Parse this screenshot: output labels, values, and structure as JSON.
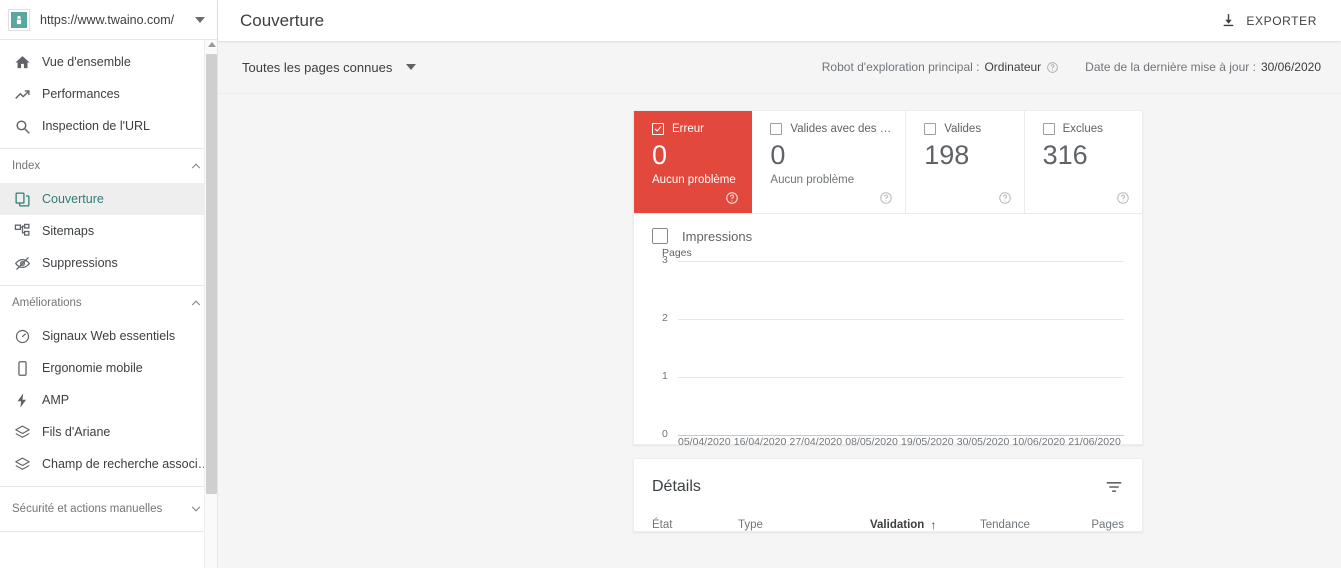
{
  "sidebar": {
    "property": {
      "url": "https://www.twaino.com/",
      "favicon_name": "site-favicon",
      "favicon_color": "#5ba6a0"
    },
    "top_items": [
      {
        "label": "Vue d'ensemble",
        "icon": "home-icon"
      },
      {
        "label": "Performances",
        "icon": "trending-up-icon"
      },
      {
        "label": "Inspection de l'URL",
        "icon": "search-icon"
      }
    ],
    "sections": [
      {
        "label": "Index",
        "expanded": true,
        "items": [
          {
            "label": "Couverture",
            "icon": "pages-copy-icon",
            "active": true
          },
          {
            "label": "Sitemaps",
            "icon": "sitemap-icon",
            "active": false
          },
          {
            "label": "Suppressions",
            "icon": "eye-off-icon",
            "active": false
          }
        ]
      },
      {
        "label": "Améliorations",
        "expanded": true,
        "items": [
          {
            "label": "Signaux Web essentiels",
            "icon": "speedometer-icon",
            "active": false
          },
          {
            "label": "Ergonomie mobile",
            "icon": "mobile-phone-icon",
            "active": false
          },
          {
            "label": "AMP",
            "icon": "lightning-bolt-icon",
            "active": false
          },
          {
            "label": "Fils d'Ariane",
            "icon": "layers-icon",
            "active": false
          },
          {
            "label": "Champ de recherche associ…",
            "icon": "layers-icon",
            "active": false
          }
        ]
      },
      {
        "label": "Sécurité et actions manuelles",
        "expanded": false,
        "items": []
      }
    ]
  },
  "topbar": {
    "title": "Couverture",
    "export_label": "EXPORTER",
    "export_icon": "download-icon"
  },
  "subbar": {
    "page_filter": "Toutes les pages connues",
    "crawler_label": "Robot d'exploration principal :",
    "crawler_value": "Ordinateur",
    "crawler_help_icon": "help-circle-icon",
    "updated_label": "Date de la dernière mise à jour :",
    "updated_value": "30/06/2020"
  },
  "status_cards": [
    {
      "title": "Erreur",
      "value": "0",
      "subtitle": "Aucun problème",
      "checked": true,
      "accent": "#e2483b",
      "help_icon": "help-circle-icon"
    },
    {
      "title": "Valides avec des …",
      "value": "0",
      "subtitle": "Aucun problème",
      "checked": false,
      "accent": "",
      "help_icon": "help-circle-icon"
    },
    {
      "title": "Valides",
      "value": "198",
      "subtitle": "",
      "checked": false,
      "accent": "",
      "help_icon": "help-circle-icon"
    },
    {
      "title": "Exclues",
      "value": "316",
      "subtitle": "",
      "checked": false,
      "accent": "",
      "help_icon": "help-circle-icon"
    }
  ],
  "chart_panel": {
    "impressions_label": "Impressions",
    "impressions_checked": false
  },
  "chart_data": {
    "type": "line",
    "title": "",
    "xlabel": "",
    "ylabel": "Pages",
    "ylim": [
      0,
      3
    ],
    "yticks": [
      "0",
      "1",
      "2",
      "3"
    ],
    "grid": true,
    "legend": "none",
    "categories": [
      "05/04/2020",
      "16/04/2020",
      "27/04/2020",
      "08/05/2020",
      "19/05/2020",
      "30/05/2020",
      "10/06/2020",
      "21/06/2020"
    ],
    "series": [
      {
        "name": "Erreur",
        "color": "#e2483b",
        "values": [
          0,
          0,
          0,
          0,
          0,
          0,
          0,
          0
        ]
      }
    ]
  },
  "details": {
    "title": "Détails",
    "filter_icon": "filter-list-icon",
    "columns": [
      {
        "key": "etat",
        "label": "État",
        "sorted": false
      },
      {
        "key": "type",
        "label": "Type",
        "sorted": false
      },
      {
        "key": "validation",
        "label": "Validation",
        "sorted": true,
        "sort_arrow": "↑"
      },
      {
        "key": "tendance",
        "label": "Tendance",
        "sorted": false
      },
      {
        "key": "pages",
        "label": "Pages",
        "sorted": false
      }
    ],
    "rows": []
  }
}
